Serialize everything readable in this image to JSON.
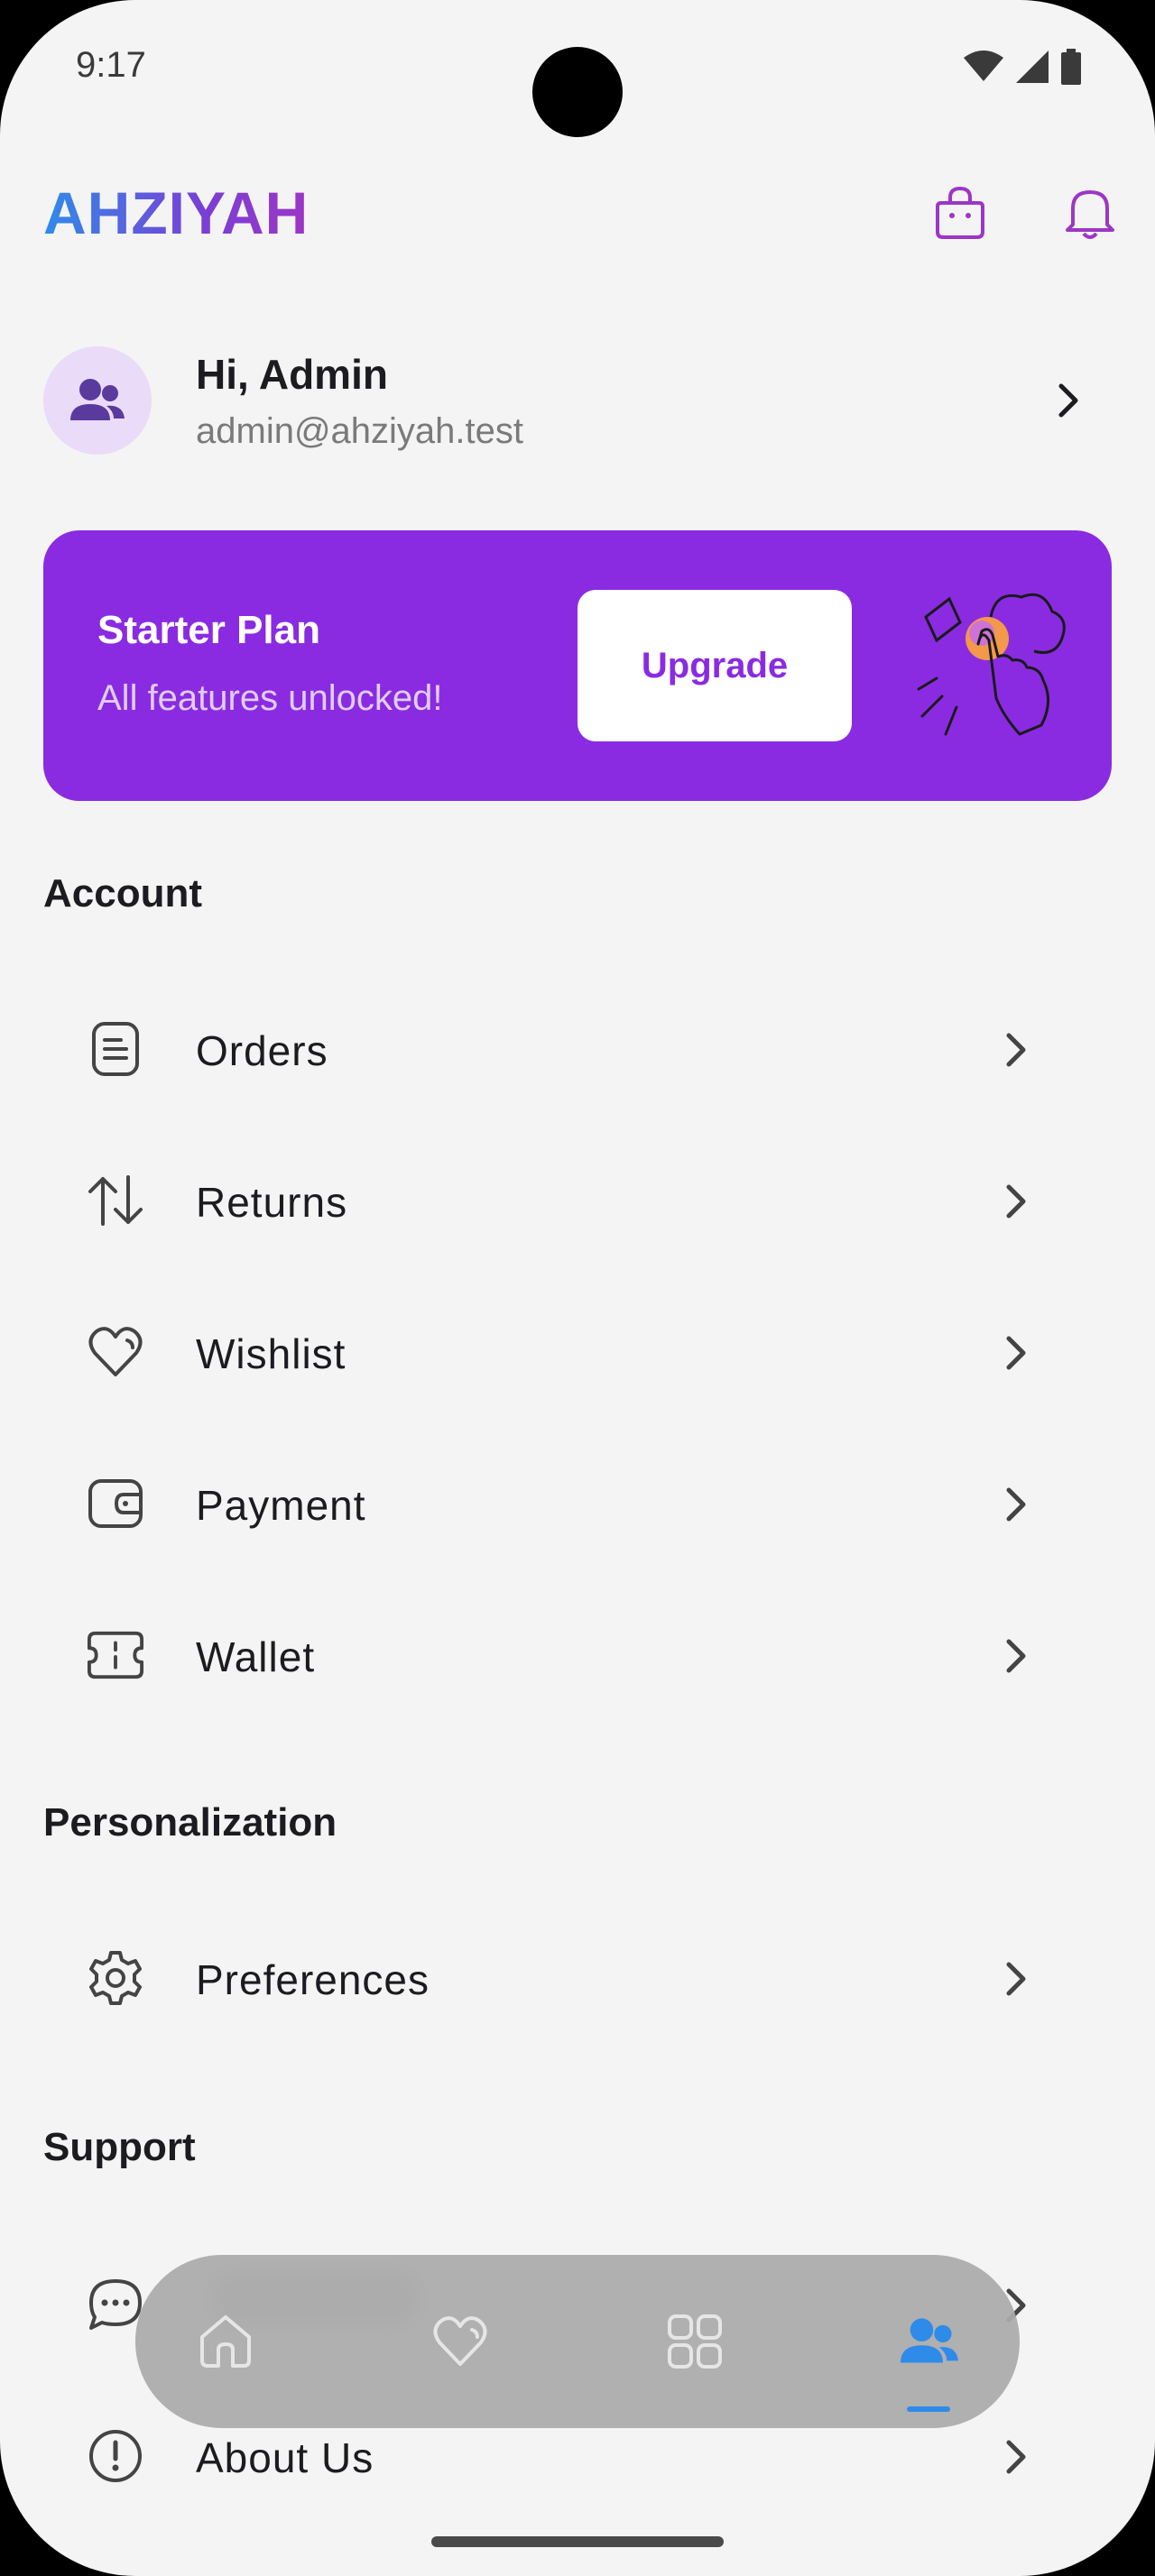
{
  "status_bar": {
    "time": "9:17"
  },
  "header": {
    "brand": "AHZIYAH",
    "cart_icon": "shopping-bag-icon",
    "notify_icon": "bell-icon"
  },
  "profile": {
    "greeting": "Hi, Admin",
    "email": "admin@ahziyah.test"
  },
  "plan": {
    "title": "Starter Plan",
    "subtitle": "All features unlocked!",
    "button": "Upgrade"
  },
  "sections": {
    "account": {
      "title": "Account",
      "items": [
        {
          "label": "Orders",
          "icon": "receipt-icon"
        },
        {
          "label": "Returns",
          "icon": "swap-arrows-icon"
        },
        {
          "label": "Wishlist",
          "icon": "heart-icon"
        },
        {
          "label": "Payment",
          "icon": "wallet-card-icon"
        },
        {
          "label": "Wallet",
          "icon": "ticket-icon"
        }
      ]
    },
    "personalization": {
      "title": "Personalization",
      "items": [
        {
          "label": "Preferences",
          "icon": "gear-icon"
        }
      ]
    },
    "support": {
      "title": "Support",
      "items": [
        {
          "label": "",
          "icon": "chat-bubble-icon"
        },
        {
          "label": "About Us",
          "icon": "info-circle-icon"
        }
      ]
    }
  },
  "bottom_nav": {
    "items": [
      {
        "icon": "home-icon"
      },
      {
        "icon": "heart-icon"
      },
      {
        "icon": "grid-icon"
      },
      {
        "icon": "users-icon"
      }
    ],
    "active_index": 3
  },
  "colors": {
    "brand_purple": "#8a2be2",
    "accent_blue": "#2f8be9",
    "background": "#f4f4f4"
  }
}
